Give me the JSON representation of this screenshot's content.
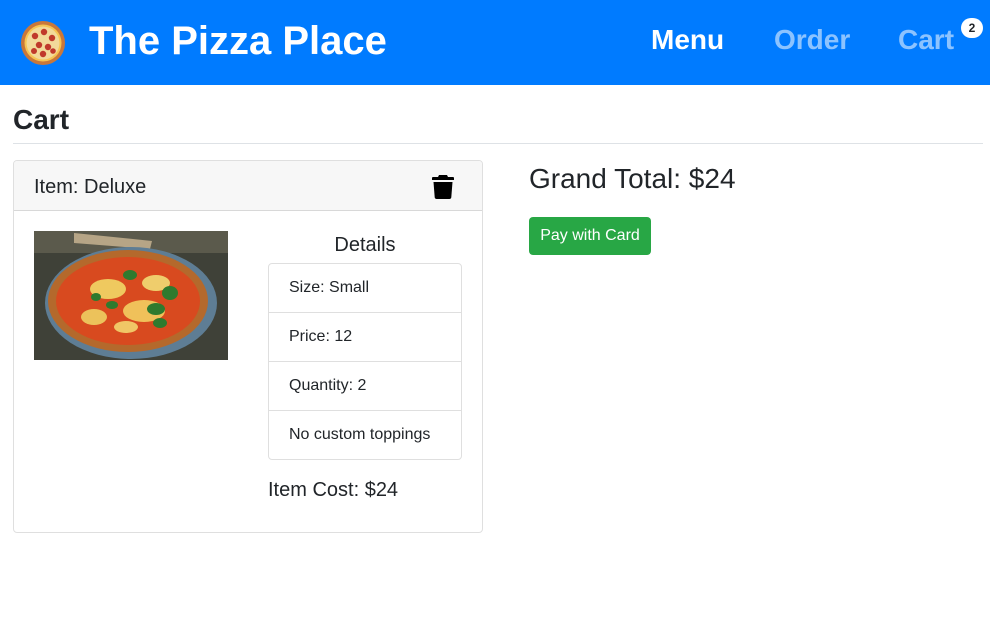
{
  "navbar": {
    "brand": "The Pizza Place",
    "logo_icon": "pizza-icon",
    "links": {
      "menu": "Menu",
      "order": "Order",
      "cart": "Cart"
    },
    "cart_count": "2",
    "background": "#007bff"
  },
  "page": {
    "heading": "Cart"
  },
  "cart_item": {
    "title": "Item: Deluxe",
    "delete_icon": "trash-icon",
    "details_title": "Details",
    "details": [
      "Size: Small",
      "Price: 12",
      "Quantity: 2",
      "No custom toppings"
    ],
    "item_cost": "Item Cost: $24"
  },
  "summary": {
    "grand_total": "Grand Total: $24",
    "pay_label": "Pay with Card",
    "pay_color": "#28a745"
  }
}
